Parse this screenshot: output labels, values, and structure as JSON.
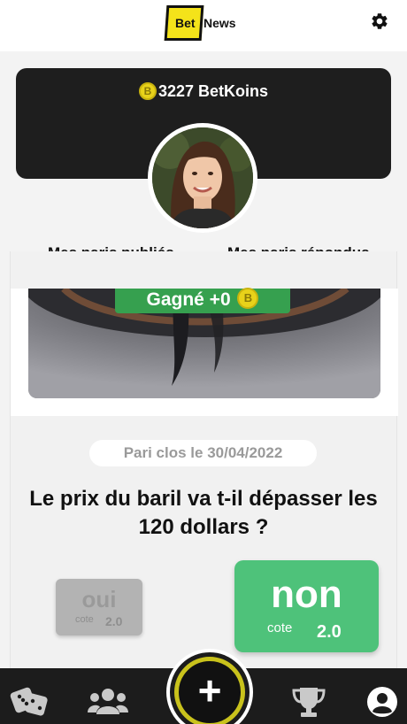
{
  "header": {
    "logo_part1": "Bet",
    "logo_part2": "News",
    "settings_icon": "gear-icon"
  },
  "profile": {
    "balance_text": "3227 BetKoins",
    "coin_symbol": "B"
  },
  "tabs": [
    {
      "label": "Mes paris publiés",
      "active": false
    },
    {
      "label": "Mes paris répondus",
      "active": true
    }
  ],
  "bet": {
    "result_text": "Gagné +0",
    "closed_text": "Pari clos le 30/04/2022",
    "question": "Le prix du baril va t-il dépasser les 120 dollars ?",
    "options": [
      {
        "label": "oui",
        "cote_label": "cote",
        "cote": "2.0",
        "selected": false
      },
      {
        "label": "non",
        "cote_label": "cote",
        "cote": "2.0",
        "selected": true
      }
    ]
  },
  "bottom_nav": {
    "items": [
      "dice-icon",
      "users-icon",
      "add-icon",
      "trophy-icon",
      "account-icon"
    ],
    "add_symbol": "+"
  },
  "colors": {
    "accent_yellow": "#f4e31a",
    "green_selected": "#4ec27a",
    "won_badge": "#36a04f",
    "dark": "#1e1e1e"
  }
}
